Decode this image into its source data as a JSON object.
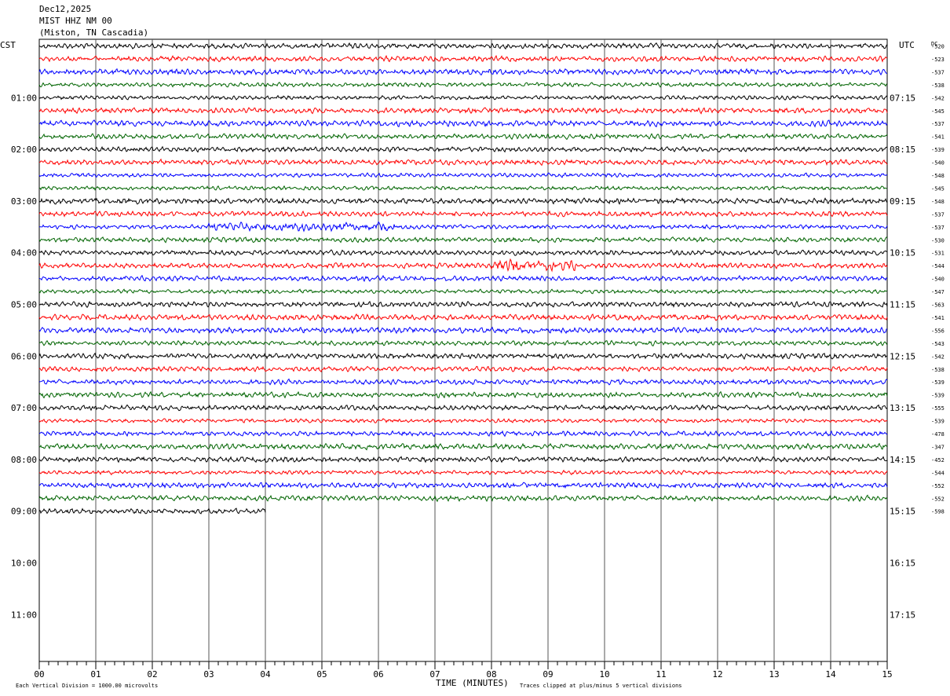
{
  "header": {
    "date": "Dec12,2025",
    "station": "MIST HHZ NM 00",
    "location": "(Miston, TN Cascadia)"
  },
  "axes": {
    "left_zone_label": "CST",
    "right_zone_label": "UTC",
    "dc_label": "DC",
    "xlabel": "TIME (MINUTES)",
    "x_ticks": [
      "00",
      "01",
      "02",
      "03",
      "04",
      "05",
      "06",
      "07",
      "08",
      "09",
      "10",
      "11",
      "12",
      "13",
      "14",
      "15"
    ]
  },
  "footer": {
    "scale_note": "Each Vertical Division = 1000.00 microvolts",
    "clip_note": "Traces clipped at plus/minus 5 vertical divisions"
  },
  "colors": {
    "trace_cycle": [
      "#000000",
      "#ff0000",
      "#0000ff",
      "#006400"
    ],
    "grid": "#000000",
    "background": "#ffffff"
  },
  "chart_data": {
    "type": "line",
    "title": "MIST HHZ NM 00",
    "xlim": [
      0,
      15
    ],
    "rows_per_hour": 4,
    "row_minutes": 15,
    "left_hour_labels": [
      "01:00",
      "02:00",
      "03:00",
      "04:00",
      "05:00",
      "06:00",
      "07:00",
      "08:00",
      "09:00",
      "10:00",
      "11:00"
    ],
    "right_hour_labels": [
      "07:15",
      "08:15",
      "09:15",
      "10:15",
      "11:15",
      "12:15",
      "13:15",
      "14:15",
      "15:15",
      "16:15",
      "17:15"
    ],
    "dc_offsets": [
      -520,
      -523,
      -537,
      -538,
      -542,
      -545,
      -537,
      -541,
      -539,
      -540,
      -548,
      -545,
      -548,
      -537,
      -537,
      -530,
      -531,
      -544,
      -540,
      -547,
      -563,
      -541,
      -556,
      -543,
      -542,
      -538,
      -539,
      -539,
      -555,
      -539,
      -478,
      -347,
      -452,
      -544,
      -552,
      -552,
      -598
    ],
    "last_row_end_minute": 4,
    "events": [
      {
        "row": 14,
        "start_minute": 3.0,
        "end_minute": 6.3,
        "description_peak_minutes": [
          5.5,
          6.0
        ]
      },
      {
        "row": 17,
        "start_minute": 8.0,
        "end_minute": 9.5,
        "description_peak_minutes": [
          8.4
        ]
      }
    ]
  }
}
